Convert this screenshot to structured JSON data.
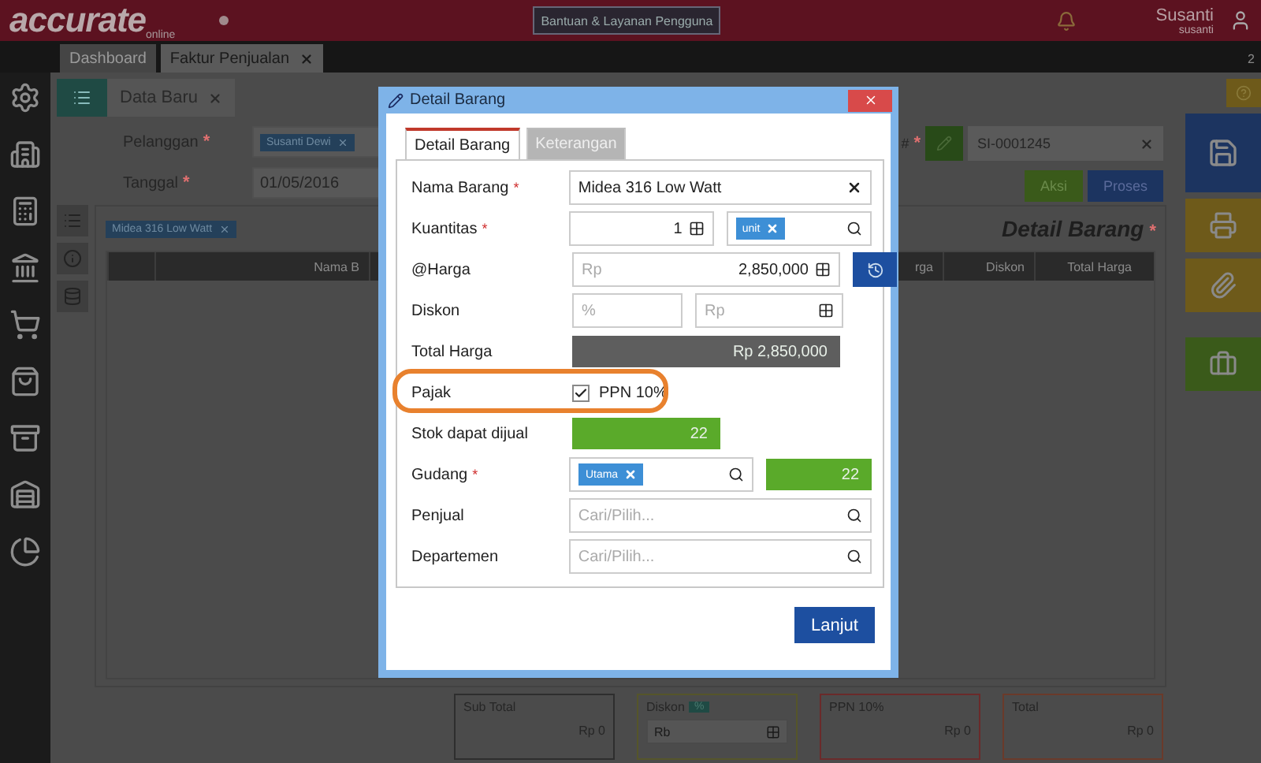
{
  "topbar": {
    "logo": "accurate",
    "logo_sub": "online",
    "help_button": "Bantuan & Layanan Pengguna",
    "user_name": "Susanti",
    "user_login": "susanti"
  },
  "app_tabs": [
    {
      "label": "Dashboard",
      "selected": false,
      "closable": false
    },
    {
      "label": "Faktur Penjualan",
      "selected": true,
      "closable": true
    }
  ],
  "tab_count": "2",
  "form_tab": {
    "label": "Data Baru"
  },
  "form": {
    "customer_label": "Pelanggan",
    "customer_mark": "*",
    "customer": "Susanti Dewi",
    "date_label": "Tanggal",
    "date_mark": "*",
    "date": "01/05/2016",
    "number_label": "#",
    "number_mark": "*",
    "number": "SI-0001245",
    "buttons": [
      "Aksi",
      "Proses"
    ]
  },
  "items": {
    "chip": "Midea 316 Low Watt",
    "title": "Detail Barang",
    "title_mark": "*",
    "columns": [
      "Nama B",
      "rga",
      "Diskon",
      "Total Harga"
    ]
  },
  "totals": [
    {
      "label": "Sub Total",
      "value": "Rp 0",
      "color": "#2e2e2e"
    },
    {
      "label": "Diskon",
      "badge": "%",
      "placeholder": "Rb",
      "color": "#55552a"
    },
    {
      "label": "PPN 10%",
      "value": "Rp 0",
      "color": "#6a2a2a"
    },
    {
      "label": "Total",
      "value": "Rp 0",
      "color": "#6a3a2a"
    }
  ],
  "dialog": {
    "title": "Detail Barang",
    "tabs": [
      {
        "label": "Detail Barang",
        "selected": true
      },
      {
        "label": "Keterangan",
        "selected": false
      }
    ],
    "fields": [
      {
        "kind": "text",
        "label": "Nama Barang",
        "mark": "*",
        "value": "Midea 316 Low Watt"
      },
      {
        "kind": "quantity",
        "label": "Kuantitas",
        "mark": "*",
        "value": "1",
        "unit": "unit"
      },
      {
        "kind": "price",
        "label": "@Harga",
        "prefix": "Rp",
        "value": "2,850,000"
      },
      {
        "kind": "discount",
        "label": "Diskon",
        "percent_placeholder": "%",
        "amount_placeholder": "Rp"
      },
      {
        "kind": "total",
        "label": "Total Harga",
        "value": "Rp 2,850,000"
      },
      {
        "kind": "checkbox",
        "label": "Pajak",
        "option": "PPN 10%",
        "checked": true,
        "highlighted": true
      },
      {
        "kind": "stock",
        "label": "Stok dapat dijual",
        "value": "22"
      },
      {
        "kind": "warehouse",
        "label": "Gudang",
        "mark": "*",
        "chip": "Utama",
        "stock": "22"
      },
      {
        "kind": "search",
        "label": "Penjual",
        "placeholder": "Cari/Pilih..."
      },
      {
        "kind": "search",
        "label": "Departemen",
        "placeholder": "Cari/Pilih..."
      }
    ],
    "submit": "Lanjut"
  }
}
